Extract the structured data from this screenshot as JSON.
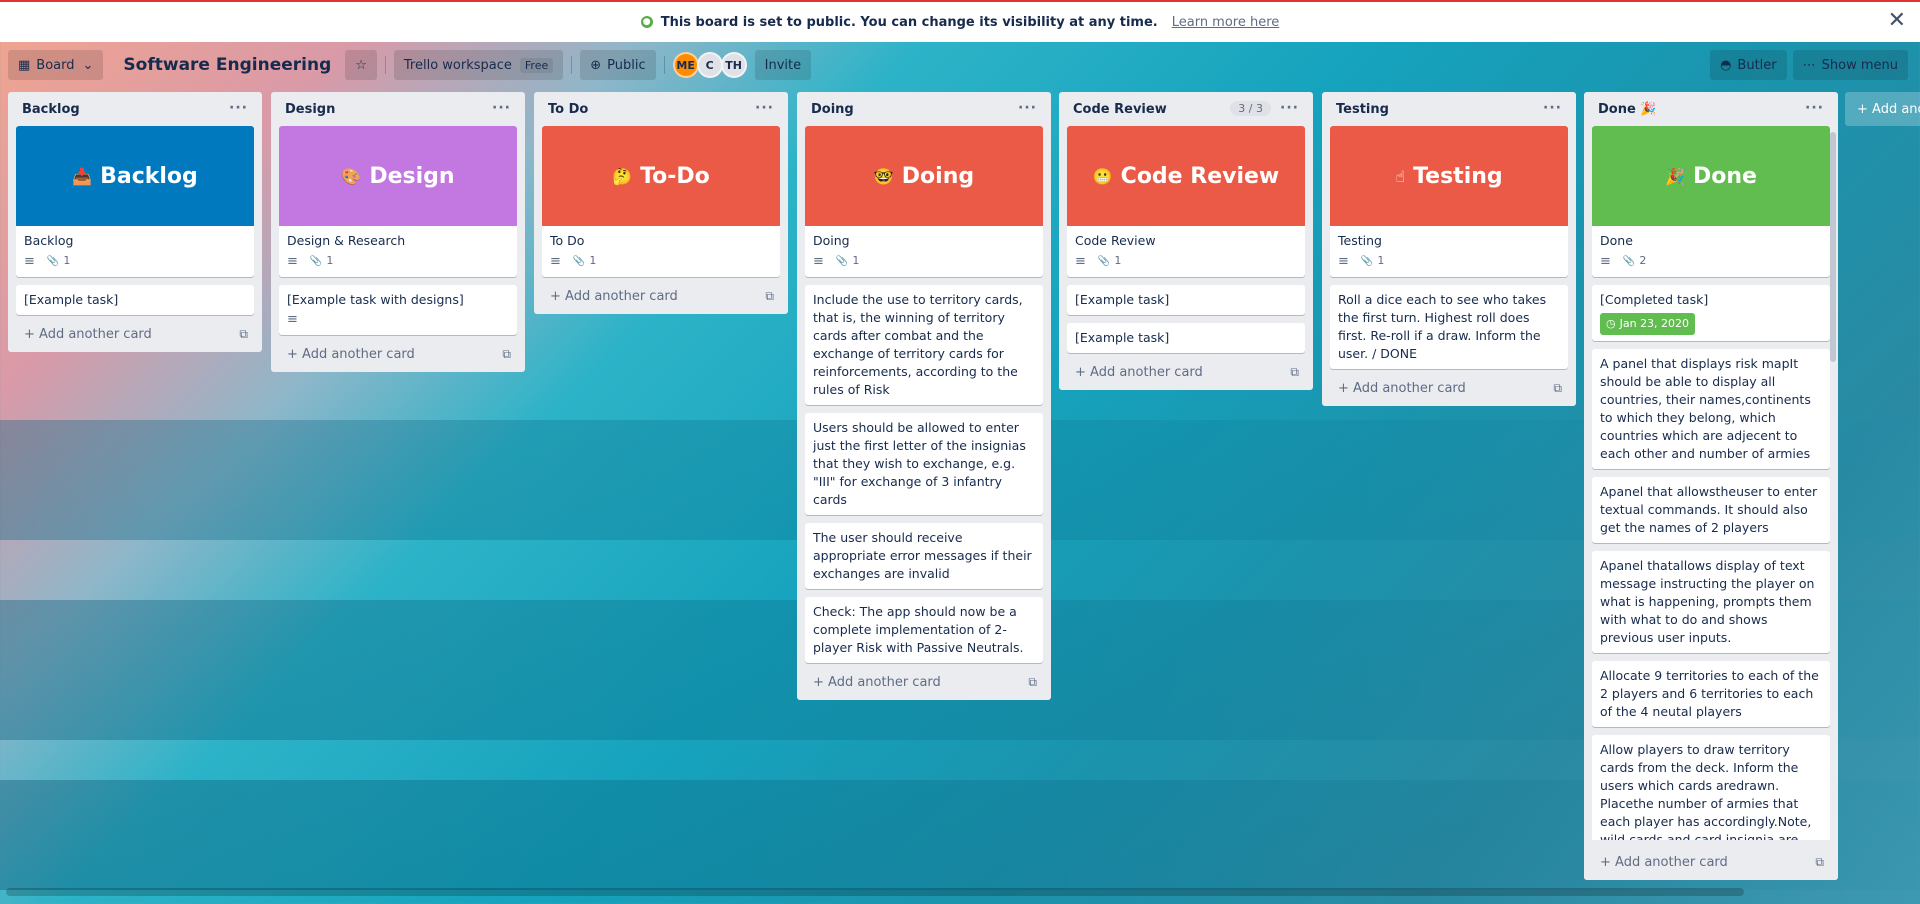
{
  "banner": {
    "text": "This board is set to public. You can change its visibility at any time.",
    "link": "Learn more here",
    "close": "✕"
  },
  "header": {
    "board_button": "Board",
    "board_icon": "▦",
    "title": "Software Engineering",
    "star": "☆",
    "workspace": "Trello workspace",
    "workspace_badge": "Free",
    "visibility": "Public",
    "visibility_icon": "⊕",
    "members": [
      "ME",
      "C",
      "TH"
    ],
    "invite": "Invite",
    "butler": "Butler",
    "show_menu": "Show menu",
    "butler_icon": "◓",
    "menu_icon": "⋯"
  },
  "lists": [
    {
      "title": "Backlog",
      "cover_text": "Backlog",
      "cover_emoji": "📥",
      "cover_color": "#0079bf",
      "cards": [
        {
          "title": "Backlog",
          "attach": "1"
        },
        {
          "title": "[Example task]"
        }
      ]
    },
    {
      "title": "Design",
      "cover_text": "Design",
      "cover_emoji": "🎨",
      "cover_color": "#c377e0",
      "cards": [
        {
          "title": "Design & Research",
          "attach": "1"
        },
        {
          "title": "[Example task with designs]"
        }
      ]
    },
    {
      "title": "To Do",
      "cover_text": "To-Do",
      "cover_emoji": "🤔",
      "cover_color": "#eb5a46",
      "cards": [
        {
          "title": "To Do",
          "attach": "1"
        }
      ]
    },
    {
      "title": "Doing",
      "cover_text": "Doing",
      "cover_emoji": "🤓",
      "cover_color": "#eb5a46",
      "cards": [
        {
          "title": "Doing",
          "attach": "1"
        },
        {
          "title": "Include the use to territory cards, that is, the winning of territory cards after combat and the exchange of territory cards for reinforcements, according to the rules of Risk"
        },
        {
          "title": "Users should be allowed to enter just the first letter of the insignias that they wish to exchange, e.g. \"III\" for exchange of 3 infantry cards"
        },
        {
          "title": "The user should receive appropriate error messages if their exchanges are invalid"
        },
        {
          "title": "Check: The app should now be a complete implementation of 2-player Risk with Passive Neutrals."
        }
      ]
    },
    {
      "title": "Code Review",
      "count": "3 / 3",
      "cover_text": "Code Review",
      "cover_emoji": "😬",
      "cover_color": "#eb5a46",
      "cards": [
        {
          "title": "Code Review",
          "attach": "1"
        },
        {
          "title": "[Example task]"
        },
        {
          "title": "[Example task]"
        }
      ]
    },
    {
      "title": "Testing",
      "cover_text": "Testing",
      "cover_emoji": "☝",
      "cover_color": "#eb5a46",
      "cards": [
        {
          "title": "Testing",
          "attach": "1"
        },
        {
          "title": "Roll a dice each to see who takes the first turn. Highest roll does first. Re-roll if a draw. Inform the user. / DONE"
        }
      ]
    },
    {
      "title": "Done 🎉",
      "cover_text": "Done",
      "cover_emoji": "🎉",
      "cover_color": "#61bd4f",
      "cards": [
        {
          "title": "Done",
          "attach": "2"
        },
        {
          "title": "[Completed task]",
          "due": "Jan 23, 2020"
        },
        {
          "title": "A panel that displays risk mapIt should be able to display all countries, their names,continents to which they belong, which countries which are adjecent to each other and number of armies"
        },
        {
          "title": "Apanel that allowstheuser to enter textual commands. It should also get the names of 2 players"
        },
        {
          "title": "Apanel thatallows display of text message instructing the player on what is happening, prompts them with what to do and shows previous user inputs."
        },
        {
          "title": "Allocate 9 territories to each of the 2 players and 6 territories to each of the 4 neutal players"
        },
        {
          "title": "Allow players to draw territory cards from the deck. Inform the users which cards aredrawn. Placethe number of armies that each player has accordingly.Note, wild cards and card insignia are not needed yet.At"
        }
      ]
    }
  ],
  "add_card_label": "+ Add another card",
  "add_list_label": "+ Add another list",
  "more_label": "···",
  "template_icon": "⧉",
  "desc_icon": "≡",
  "attach_icon": "📎",
  "clock_icon": "◷"
}
